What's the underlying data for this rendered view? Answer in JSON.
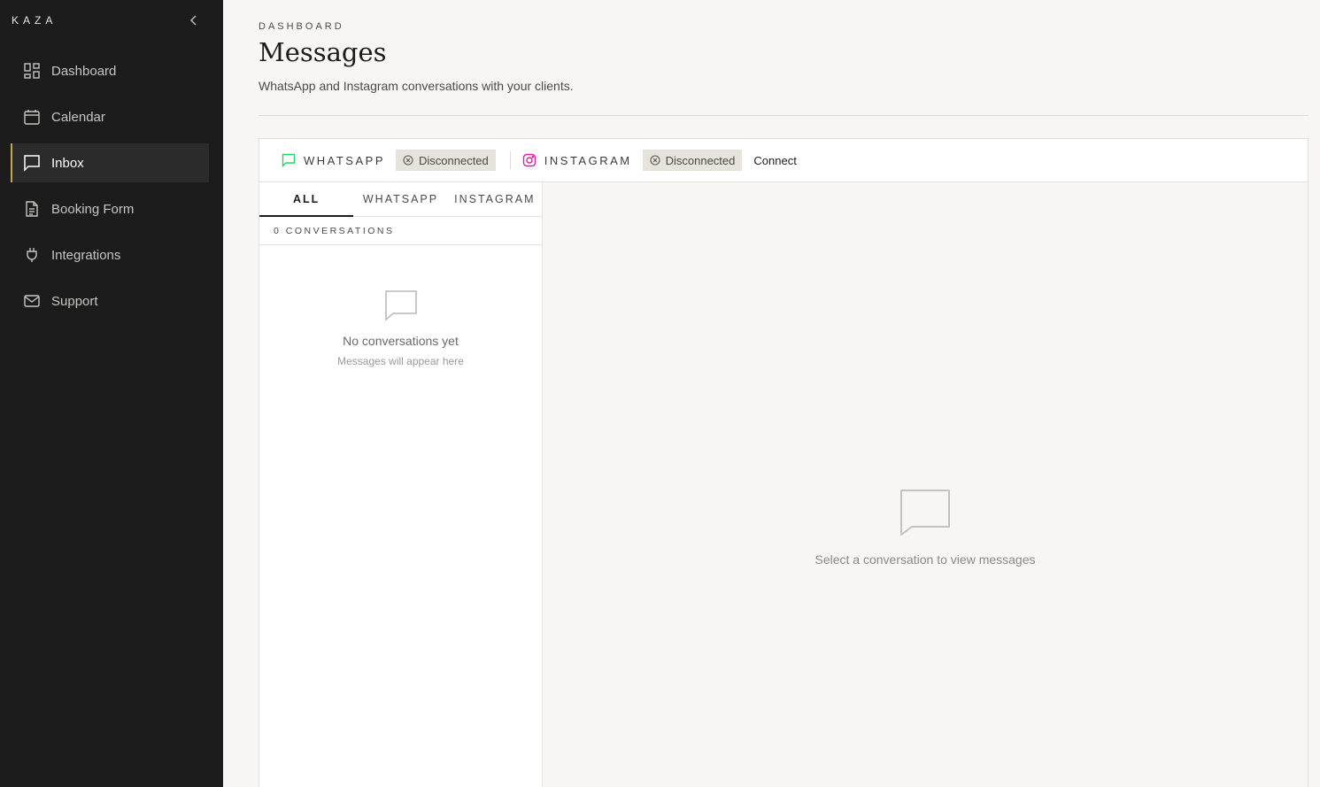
{
  "brand": "KAZA",
  "sidebar": {
    "items": [
      {
        "label": "Dashboard",
        "icon": "grid-icon",
        "active": false
      },
      {
        "label": "Calendar",
        "icon": "calendar-icon",
        "active": false
      },
      {
        "label": "Inbox",
        "icon": "message-icon",
        "active": true
      },
      {
        "label": "Booking Form",
        "icon": "document-icon",
        "active": false
      },
      {
        "label": "Integrations",
        "icon": "plug-icon",
        "active": false
      },
      {
        "label": "Support",
        "icon": "mail-icon",
        "active": false
      }
    ]
  },
  "header": {
    "eyebrow": "DASHBOARD",
    "title": "Messages",
    "subtitle": "WhatsApp and Instagram conversations with your clients."
  },
  "channels": {
    "whatsapp": {
      "label": "WHATSAPP",
      "status": "Disconnected"
    },
    "instagram": {
      "label": "INSTAGRAM",
      "status": "Disconnected"
    },
    "connect_label": "Connect"
  },
  "tabs": [
    {
      "label": "ALL",
      "active": true
    },
    {
      "label": "WHATSAPP",
      "active": false
    },
    {
      "label": "INSTAGRAM",
      "active": false
    }
  ],
  "list": {
    "count_label": "0 CONVERSATIONS",
    "empty_title": "No conversations yet",
    "empty_subtitle": "Messages will appear here"
  },
  "detail": {
    "empty_text": "Select a conversation to view messages"
  },
  "colors": {
    "sidebar_bg": "#1c1c1c",
    "accent": "#c9a84a",
    "whatsapp_green": "#25d366",
    "instagram_pink": "#d6249f",
    "page_bg": "#f7f6f4"
  }
}
